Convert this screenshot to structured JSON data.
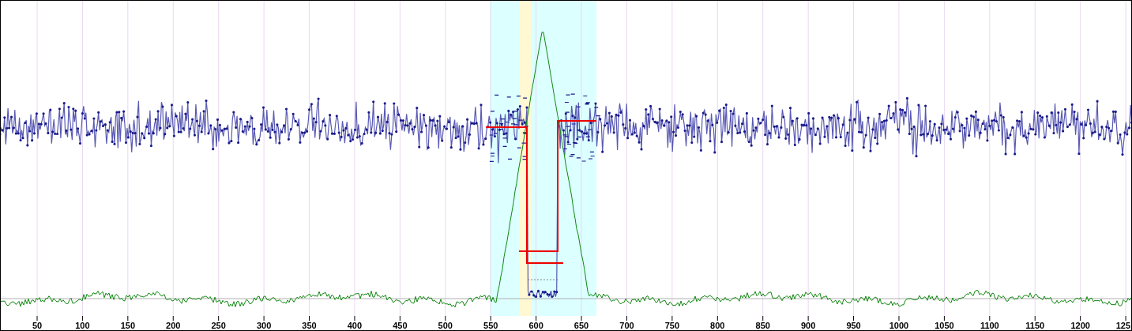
{
  "x_axis": {
    "labels": [
      "50",
      "100",
      "150",
      "200",
      "250",
      "300",
      "350",
      "400",
      "450",
      "500",
      "550",
      "600",
      "650",
      "700",
      "750",
      "800",
      "850",
      "900",
      "950",
      "1000",
      "1050",
      "1100",
      "1150",
      "1200",
      "125"
    ]
  }
}
